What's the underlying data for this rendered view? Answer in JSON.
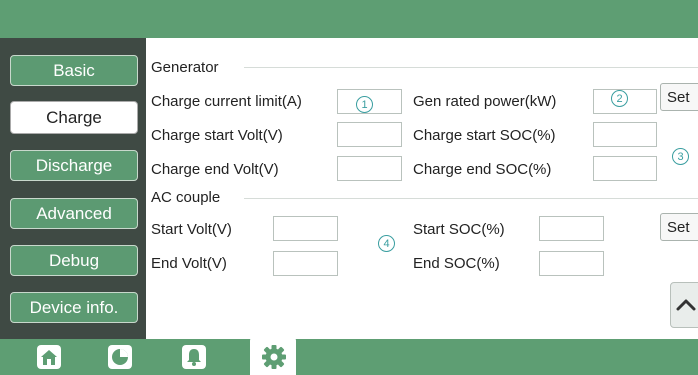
{
  "sidebar": {
    "items": [
      {
        "label": "Basic",
        "active": false
      },
      {
        "label": "Charge",
        "active": true
      },
      {
        "label": "Discharge",
        "active": false
      },
      {
        "label": "Advanced",
        "active": false
      },
      {
        "label": "Debug",
        "active": false
      },
      {
        "label": "Device info.",
        "active": false
      }
    ]
  },
  "generator": {
    "title": "Generator",
    "charge_current_limit": {
      "label": "Charge current limit(A)",
      "value": "",
      "marker": "1"
    },
    "gen_rated_power": {
      "label": "Gen rated power(kW)",
      "value": "",
      "marker": "2"
    },
    "charge_start_volt": {
      "label": "Charge start Volt(V)",
      "value": ""
    },
    "charge_start_soc": {
      "label": "Charge start SOC(%)",
      "value": ""
    },
    "charge_end_volt": {
      "label": "Charge end Volt(V)",
      "value": ""
    },
    "charge_end_soc": {
      "label": "Charge end SOC(%)",
      "value": ""
    },
    "section_marker": "3",
    "set_label": "Set"
  },
  "ac_couple": {
    "title": "AC couple",
    "start_volt": {
      "label": "Start Volt(V)",
      "value": ""
    },
    "end_volt": {
      "label": "End Volt(V)",
      "value": ""
    },
    "start_soc": {
      "label": "Start SOC(%)",
      "value": ""
    },
    "end_soc": {
      "label": "End SOC(%)",
      "value": ""
    },
    "section_marker": "4",
    "set_label": "Set"
  },
  "bottom_nav": {
    "items": [
      {
        "icon": "home-icon",
        "active": false
      },
      {
        "icon": "pie-chart-icon",
        "active": false
      },
      {
        "icon": "bell-icon",
        "active": false
      },
      {
        "icon": "gear-icon",
        "active": true
      }
    ]
  },
  "colors": {
    "brand_green": "#5e9e73",
    "sidebar_bg": "#3f4a44",
    "marker": "#3a9ea0"
  }
}
